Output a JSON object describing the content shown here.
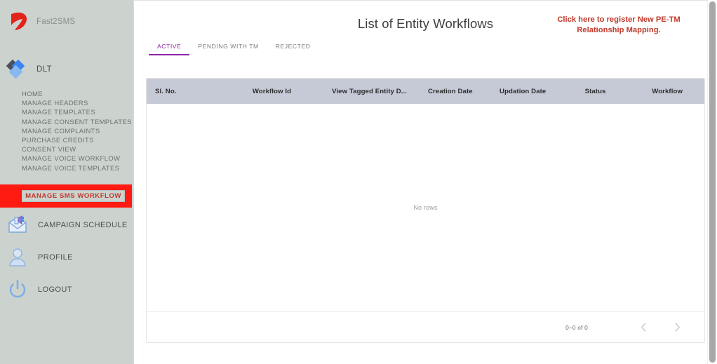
{
  "sidebar": {
    "brand": {
      "name": "Fast2SMS",
      "logo_icon": "fast2sms-swirl-logo"
    },
    "section": {
      "label": "DLT",
      "icon": "dlt-diamond-icon"
    },
    "items": [
      {
        "label": "HOME"
      },
      {
        "label": "MANAGE HEADERS"
      },
      {
        "label": "MANAGE TEMPLATES"
      },
      {
        "label": "MANAGE CONSENT TEMPLATES"
      },
      {
        "label": "MANAGE COMPLAINTS"
      },
      {
        "label": "PURCHASE CREDITS"
      },
      {
        "label": "CONSENT VIEW"
      },
      {
        "label": "MANAGE VOICE WORKFLOW"
      },
      {
        "label": "MANAGE VOICE TEMPLATES"
      }
    ],
    "highlighted_item": {
      "label": "MANAGE SMS WORKFLOW",
      "highlight_color": "#ff1b12",
      "text_color": "#c1392b"
    },
    "bottom_items": [
      {
        "label": "CAMPAIGN SCHEDULE",
        "icon": "campaign-envelope-icon"
      },
      {
        "label": "PROFILE",
        "icon": "user-icon"
      },
      {
        "label": "LOGOUT",
        "icon": "power-icon"
      }
    ],
    "background_color": "#ccd3ce"
  },
  "header": {
    "title": "List of Entity Workflows",
    "register_link": "Click here to register New PE-TM Relationship Mapping.",
    "register_link_color": "#c0392b"
  },
  "tabs": {
    "accent_color": "#8e24aa",
    "items": [
      {
        "label": "ACTIVE",
        "active": true
      },
      {
        "label": "PENDING WITH TM",
        "active": false
      },
      {
        "label": "REJECTED",
        "active": false
      }
    ]
  },
  "table": {
    "header_background": "#c5cad6",
    "columns": [
      "Sl. No.",
      "Workflow Id",
      "View Tagged Entity D...",
      "Creation Date",
      "Updation Date",
      "Status",
      "Workflow"
    ],
    "rows": [],
    "empty_message": "No rows"
  },
  "pagination": {
    "range_label": "0–0 of 0",
    "prev_icon": "chevron-left-icon",
    "next_icon": "chevron-right-icon"
  }
}
